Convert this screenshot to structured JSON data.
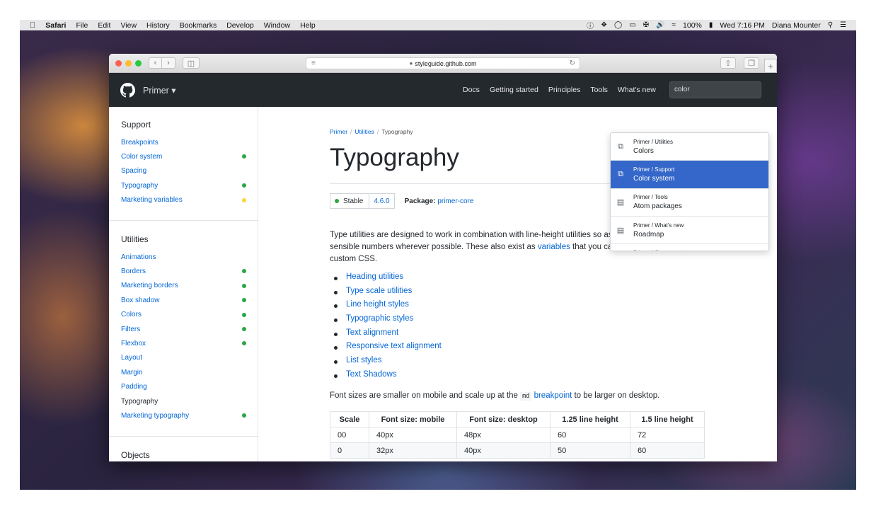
{
  "menubar": {
    "app": "Safari",
    "menus": [
      "File",
      "Edit",
      "View",
      "History",
      "Bookmarks",
      "Develop",
      "Window",
      "Help"
    ],
    "battery": "100%",
    "datetime": "Wed 7:16 PM",
    "user": "Diana Mounter"
  },
  "browser": {
    "url": "styleguide.github.com"
  },
  "header": {
    "brand": "Primer ▾",
    "nav": [
      "Docs",
      "Getting started",
      "Principles",
      "Tools",
      "What's new"
    ],
    "search_value": "color"
  },
  "sidebar": {
    "sections": [
      {
        "heading": "Support",
        "items": [
          {
            "label": "Breakpoints",
            "dot": ""
          },
          {
            "label": "Color system",
            "dot": "#28a745"
          },
          {
            "label": "Spacing",
            "dot": ""
          },
          {
            "label": "Typography",
            "dot": "#28a745"
          },
          {
            "label": "Marketing variables",
            "dot": "#ffd33d"
          }
        ]
      },
      {
        "heading": "Utilities",
        "items": [
          {
            "label": "Animations",
            "dot": ""
          },
          {
            "label": "Borders",
            "dot": "#28a745"
          },
          {
            "label": "Marketing borders",
            "dot": "#28a745"
          },
          {
            "label": "Box shadow",
            "dot": "#28a745"
          },
          {
            "label": "Colors",
            "dot": "#28a745"
          },
          {
            "label": "Filters",
            "dot": "#28a745"
          },
          {
            "label": "Flexbox",
            "dot": "#28a745"
          },
          {
            "label": "Layout",
            "dot": ""
          },
          {
            "label": "Margin",
            "dot": ""
          },
          {
            "label": "Padding",
            "dot": ""
          },
          {
            "label": "Typography",
            "dot": "",
            "current": true
          },
          {
            "label": "Marketing typography",
            "dot": "#28a745"
          }
        ]
      },
      {
        "heading": "Objects",
        "items": []
      }
    ]
  },
  "main": {
    "breadcrumb": [
      "Primer",
      "Utilities",
      "Typography"
    ],
    "title": "Typography",
    "status": "Stable",
    "version": "4.6.0",
    "package_label": "Package:",
    "package_name": "primer-core",
    "intro_before_link": "Type utilities are designed to work in combination with line-height utilities so as to result in more sensible numbers wherever possible. These also exist as ",
    "intro_link": "variables",
    "intro_after_link": " that you can use in components or custom CSS.",
    "toc": [
      "Heading utilities",
      "Type scale utilities",
      "Line height styles",
      "Typographic styles",
      "Text alignment",
      "Responsive text alignment",
      "List styles",
      "Text Shadows"
    ],
    "font_note_before": "Font sizes are smaller on mobile and scale up at the ",
    "font_note_code": "md",
    "font_note_link": "breakpoint",
    "font_note_after": " to be larger on desktop.",
    "table": {
      "headers": [
        "Scale",
        "Font size: mobile",
        "Font size: desktop",
        "1.25 line height",
        "1.5 line height"
      ],
      "rows": [
        [
          "00",
          "40px",
          "48px",
          "60",
          "72"
        ],
        [
          "0",
          "32px",
          "40px",
          "50",
          "60"
        ]
      ]
    }
  },
  "search_results": [
    {
      "path": "Primer / Utilities",
      "label": "Colors",
      "icon": "package-icon",
      "active": false
    },
    {
      "path": "Primer / Support",
      "label": "Color system",
      "icon": "package-icon",
      "active": true
    },
    {
      "path": "Primer / Tools",
      "label": "Atom packages",
      "icon": "book-icon",
      "active": false
    },
    {
      "path": "Primer / What's new",
      "label": "Roadmap",
      "icon": "book-icon",
      "active": false
    }
  ],
  "search_results_partial": "Primer / Components"
}
